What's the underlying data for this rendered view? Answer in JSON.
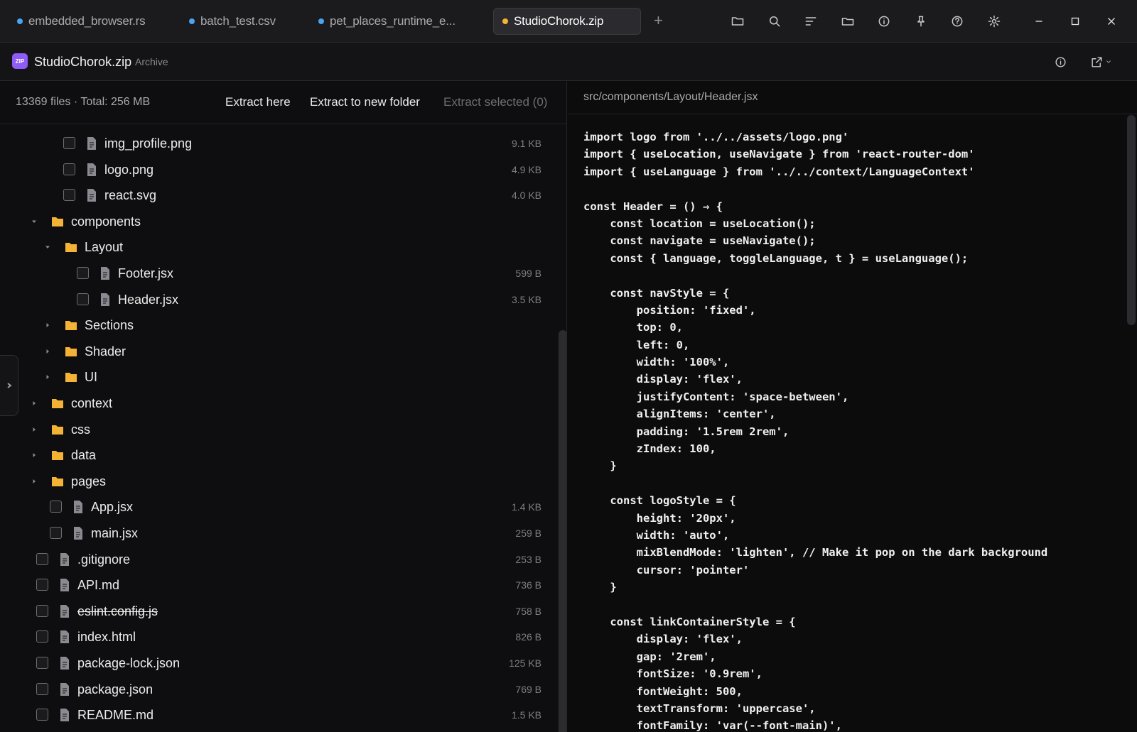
{
  "tabs": [
    {
      "label": "embedded_browser.rs",
      "active": false
    },
    {
      "label": "batch_test.csv",
      "active": false
    },
    {
      "label": "pet_places_runtime_e...",
      "active": false
    },
    {
      "label": "StudioChorok.zip",
      "active": true
    }
  ],
  "tab_add": "+",
  "toolbar_icons": [
    "folder-open-icon",
    "search-icon",
    "sort-icon",
    "folder-icon",
    "info-icon",
    "pin-icon",
    "help-icon",
    "settings-icon"
  ],
  "header": {
    "badge": "ZIP",
    "archive_name": "StudioChorok.zip",
    "archive_type": "Archive"
  },
  "left": {
    "summary": "13369 files · Total: 256 MB",
    "extract_here": "Extract here",
    "extract_new_folder": "Extract to new folder",
    "extract_selected": "Extract selected (0)",
    "rows": [
      {
        "name": "img_profile.png",
        "type": "file",
        "depth": 3,
        "size": "9.1 KB"
      },
      {
        "name": "logo.png",
        "type": "file",
        "depth": 3,
        "size": "4.9 KB"
      },
      {
        "name": "react.svg",
        "type": "file",
        "depth": 3,
        "size": "4.0 KB"
      },
      {
        "name": "components",
        "type": "folder",
        "depth": 1,
        "expanded": true,
        "size": ""
      },
      {
        "name": "Layout",
        "type": "folder",
        "depth": 2,
        "expanded": true,
        "size": ""
      },
      {
        "name": "Footer.jsx",
        "type": "file",
        "depth": 4,
        "size": "599 B"
      },
      {
        "name": "Header.jsx",
        "type": "file",
        "depth": 4,
        "size": "3.5 KB"
      },
      {
        "name": "Sections",
        "type": "folder",
        "depth": 2,
        "expanded": false,
        "size": ""
      },
      {
        "name": "Shader",
        "type": "folder",
        "depth": 2,
        "expanded": false,
        "size": ""
      },
      {
        "name": "UI",
        "type": "folder",
        "depth": 2,
        "expanded": false,
        "size": ""
      },
      {
        "name": "context",
        "type": "folder",
        "depth": 1,
        "expanded": false,
        "size": ""
      },
      {
        "name": "css",
        "type": "folder",
        "depth": 1,
        "expanded": false,
        "size": ""
      },
      {
        "name": "data",
        "type": "folder",
        "depth": 1,
        "expanded": false,
        "size": ""
      },
      {
        "name": "pages",
        "type": "folder",
        "depth": 1,
        "expanded": false,
        "size": ""
      },
      {
        "name": "App.jsx",
        "type": "file",
        "depth": 2,
        "size": "1.4 KB"
      },
      {
        "name": "main.jsx",
        "type": "file",
        "depth": 2,
        "size": "259 B"
      },
      {
        "name": ".gitignore",
        "type": "file",
        "depth": 1,
        "size": "253 B"
      },
      {
        "name": "API.md",
        "type": "file",
        "depth": 1,
        "size": "736 B"
      },
      {
        "name": "eslint.config.js",
        "type": "file",
        "depth": 1,
        "size": "758 B",
        "strike": true
      },
      {
        "name": "index.html",
        "type": "file",
        "depth": 1,
        "size": "826 B"
      },
      {
        "name": "package-lock.json",
        "type": "file",
        "depth": 1,
        "size": "125 KB"
      },
      {
        "name": "package.json",
        "type": "file",
        "depth": 1,
        "size": "769 B"
      },
      {
        "name": "README.md",
        "type": "file",
        "depth": 1,
        "size": "1.5 KB"
      }
    ]
  },
  "right": {
    "path": "src/components/Layout/Header.jsx",
    "code_lines": [
      "import logo from '../../assets/logo.png'",
      "import { useLocation, useNavigate } from 'react-router-dom'",
      "import { useLanguage } from '../../context/LanguageContext'",
      "",
      "const Header = () ⇒ {",
      "    const location = useLocation();",
      "    const navigate = useNavigate();",
      "    const { language, toggleLanguage, t } = useLanguage();",
      "",
      "    const navStyle = {",
      "        position: 'fixed',",
      "        top: 0,",
      "        left: 0,",
      "        width: '100%',",
      "        display: 'flex',",
      "        justifyContent: 'space-between',",
      "        alignItems: 'center',",
      "        padding: '1.5rem 2rem',",
      "        zIndex: 100,",
      "    }",
      "",
      "    const logoStyle = {",
      "        height: '20px',",
      "        width: 'auto',",
      "        mixBlendMode: 'lighten', // Make it pop on the dark background",
      "        cursor: 'pointer'",
      "    }",
      "",
      "    const linkContainerStyle = {",
      "        display: 'flex',",
      "        gap: '2rem',",
      "        fontSize: '0.9rem',",
      "        fontWeight: 500,",
      "        textTransform: 'uppercase',",
      "        fontFamily: 'var(--font-main)',"
    ]
  },
  "colors": {
    "accent_zip": "#8f5cf5",
    "folder": "#f5b335",
    "tab_dot": "#4aa3f0",
    "active_tab_dot": "#f5b335"
  }
}
